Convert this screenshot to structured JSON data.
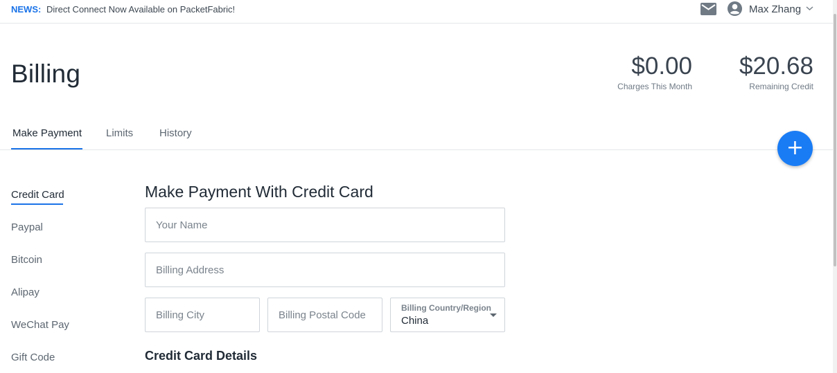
{
  "news": {
    "tag": "NEWS:",
    "text": "Direct Connect Now Available on PacketFabric!"
  },
  "header": {
    "mail_icon": "mail-icon",
    "user_icon": "account-circle-icon",
    "user_name": "Max Zhang",
    "menu_icon": "chevron-down-icon"
  },
  "page": {
    "title": "Billing"
  },
  "stats": {
    "charges": {
      "amount": "$0.00",
      "caption": "Charges This Month"
    },
    "credit": {
      "amount": "$20.68",
      "caption": "Remaining Credit"
    }
  },
  "tabs": [
    {
      "label": "Make Payment",
      "active": true
    },
    {
      "label": "Limits",
      "active": false
    },
    {
      "label": "History",
      "active": false
    }
  ],
  "fab": {
    "icon": "plus-icon",
    "symbol": "+"
  },
  "side_nav": [
    {
      "label": "Credit Card",
      "active": true
    },
    {
      "label": "Paypal",
      "active": false
    },
    {
      "label": "Bitcoin",
      "active": false
    },
    {
      "label": "Alipay",
      "active": false
    },
    {
      "label": "WeChat Pay",
      "active": false
    },
    {
      "label": "Gift Code",
      "active": false
    }
  ],
  "form": {
    "title": "Make Payment With Credit Card",
    "name": {
      "placeholder": "Your Name",
      "value": ""
    },
    "address": {
      "placeholder": "Billing Address",
      "value": ""
    },
    "city": {
      "placeholder": "Billing City",
      "value": ""
    },
    "postal": {
      "placeholder": "Billing Postal Code",
      "value": ""
    },
    "country": {
      "label": "Billing Country/Region",
      "value": "China"
    },
    "card_section_title": "Credit Card Details"
  },
  "colors": {
    "accent": "#1a73e8",
    "fab": "#1a7cf5",
    "text": "#212b36",
    "muted": "#5c6670"
  }
}
